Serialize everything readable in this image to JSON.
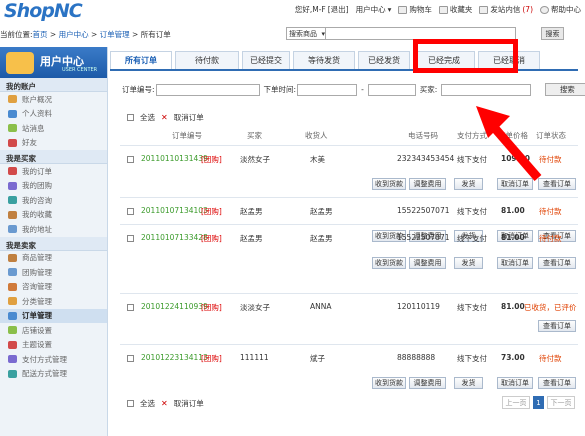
{
  "brand": {
    "logo": "ShopNC"
  },
  "header": {
    "greeting": "您好,M-F",
    "logout": "[退出]",
    "user_center": "用户中心",
    "cart": "购物车",
    "favorites": "收藏夹",
    "inbox": "发站内信",
    "inbox_count": "(7)",
    "help": "帮助中心"
  },
  "breadcrumb": {
    "prefix": "当前位置:",
    "items": [
      "首页",
      "用户中心",
      "订单管理"
    ],
    "current": "所有订单",
    "sep": " > "
  },
  "search": {
    "category": "搜索商品",
    "button": "搜索"
  },
  "sidebar": {
    "title": "用户中心",
    "subtitle": "USER CENTER",
    "sections": [
      {
        "title": "我的账户",
        "items": [
          "账户概况",
          "个人资料",
          "站消息",
          "好友"
        ]
      },
      {
        "title": "我是买家",
        "items": [
          "我的订单",
          "我的团购",
          "我的咨询",
          "我的收藏",
          "我的地址"
        ]
      },
      {
        "title": "我是卖家",
        "items": [
          "商品管理",
          "团购管理",
          "咨询管理",
          "分类管理",
          "订单管理",
          "店铺设置",
          "主题设置",
          "支付方式管理",
          "配送方式管理"
        ]
      }
    ],
    "active": "订单管理"
  },
  "tabs": [
    "所有订单",
    "待付款",
    "已经提交",
    "等待发货",
    "已经发货",
    "已经完成",
    "已经取消"
  ],
  "active_tab": "所有订单",
  "filter": {
    "order_no_label": "订单编号:",
    "time_label": "下单时间:",
    "dash": "-",
    "buyer_label": "买家:",
    "search_button": "搜索"
  },
  "bulk": {
    "select_all": "全选",
    "cancel_order": "取消订单"
  },
  "columns": [
    "订单编号",
    "买家",
    "收货人",
    "电话号码",
    "支付方式",
    "订单价格",
    "订单状态"
  ],
  "orders": [
    {
      "id": "20110110131439",
      "tag": "[团购]",
      "buyer": "淡然女子",
      "receiver": "木美",
      "phone": "232343453454",
      "payment": "线下支付",
      "price": "109.00",
      "status": "待付款",
      "buttons": [
        "收到货款",
        "调整费用",
        "发货",
        "取消订单",
        "查看订单"
      ]
    },
    {
      "id": "20110107134103",
      "tag": "[团购]",
      "buyer": "赵孟男",
      "receiver": "赵孟男",
      "phone": "15522507071",
      "payment": "线下支付",
      "price": "81.00",
      "status": "待付款",
      "buttons": [
        "收到货款",
        "调整费用",
        "发货",
        "取消订单",
        "查看订单"
      ]
    },
    {
      "id": "20110107133428",
      "tag": "[团购]",
      "buyer": "赵孟男",
      "receiver": "赵孟男",
      "phone": "15522507071",
      "payment": "线下支付",
      "price": "81.00",
      "status": "待付款",
      "buttons": [
        "收到货款",
        "调整费用",
        "发货",
        "取消订单",
        "查看订单"
      ]
    },
    {
      "id": "20101224110939",
      "tag": "[团购]",
      "buyer": "淡淡女子",
      "receiver": "ANNA",
      "phone": "120110119",
      "payment": "线下支付",
      "price": "81.00",
      "status": "已收货，已评价",
      "buttons": [
        "查看订单"
      ]
    },
    {
      "id": "20101223134113",
      "tag": "[团购]",
      "buyer": "111111",
      "receiver": "斌子",
      "phone": "88888888",
      "payment": "线下支付",
      "price": "73.00",
      "status": "待付款",
      "buttons": [
        "收到货款",
        "调整费用",
        "发货",
        "取消订单",
        "查看订单"
      ]
    }
  ],
  "pagination": {
    "prev": "上一页",
    "current": "1",
    "next": "下一页"
  },
  "colors": {
    "accent": "#2f6cb3",
    "highlight": "#ff0000",
    "order_id": "#3a9a2a",
    "status": "#e04000"
  }
}
